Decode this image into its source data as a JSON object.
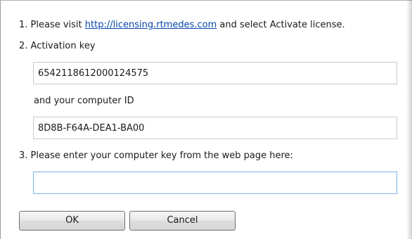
{
  "dialog": {
    "step1_prefix": "1. Please visit ",
    "step1_link": "http://licensing.rtmedes.com",
    "step1_suffix": " and select Activate license.",
    "step2_label": "2. Activation key",
    "activation_key": "6542118612000124575",
    "computer_id_label": "and your computer ID",
    "computer_id": "8D8B-F64A-DEA1-BA00",
    "step3_label": "3. Please enter your computer key from the web page here:",
    "computer_key_value": "",
    "computer_key_placeholder": ""
  },
  "buttons": {
    "ok_label": "OK",
    "cancel_label": "Cancel"
  },
  "colors": {
    "link": "#0645ad",
    "field_border": "#abadb3",
    "focus_border": "#7eb4ea",
    "button_border": "#707070"
  }
}
